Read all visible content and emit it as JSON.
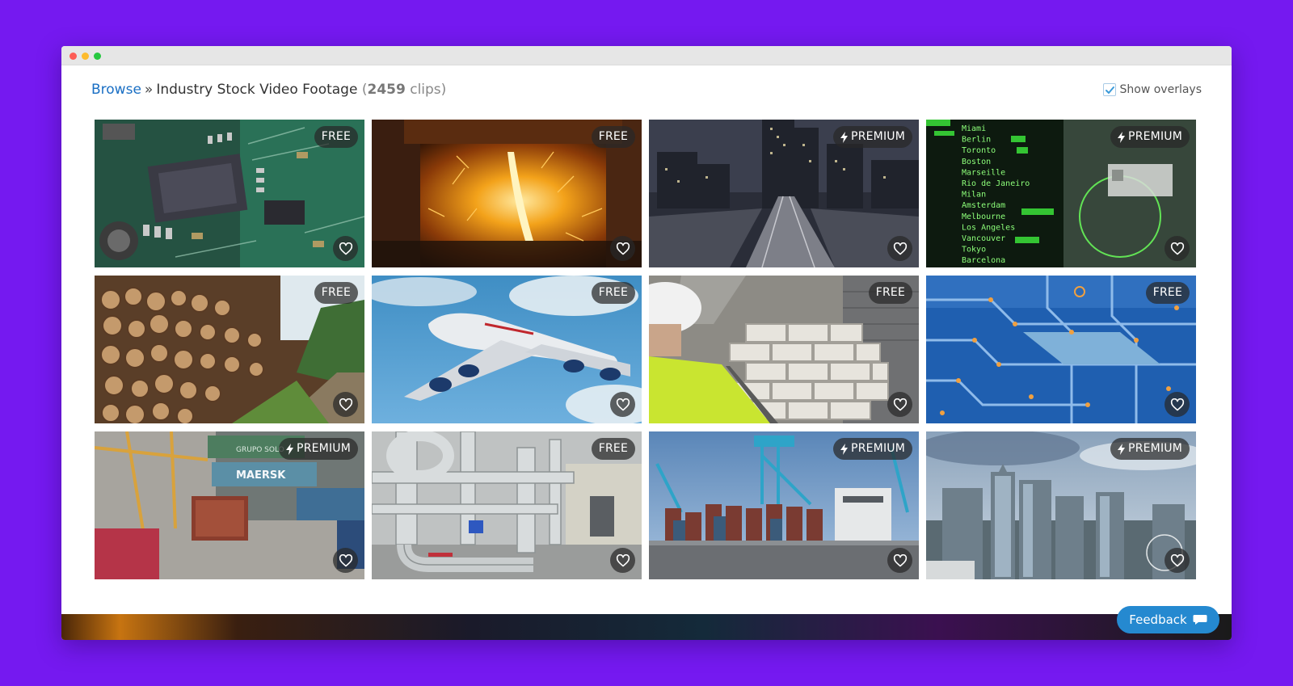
{
  "breadcrumb": {
    "root": "Browse",
    "separator": "»",
    "category": "Industry Stock Video Footage",
    "count_open": "(",
    "count_value": "2459",
    "count_unit": " clips)"
  },
  "overlay_toggle": {
    "label": "Show overlays",
    "checked": true
  },
  "clips": [
    {
      "badge": "FREE",
      "premium": false,
      "thumb": "circuit-board"
    },
    {
      "badge": "FREE",
      "premium": false,
      "thumb": "molten-metal"
    },
    {
      "badge": "PREMIUM",
      "premium": true,
      "thumb": "city-rail-night"
    },
    {
      "badge": "PREMIUM",
      "premium": true,
      "thumb": "airport-departures-board"
    },
    {
      "badge": "FREE",
      "premium": false,
      "thumb": "log-pile"
    },
    {
      "badge": "FREE",
      "premium": false,
      "thumb": "airplane"
    },
    {
      "badge": "FREE",
      "premium": false,
      "thumb": "bricklayer"
    },
    {
      "badge": "FREE",
      "premium": false,
      "thumb": "blue-circuit"
    },
    {
      "badge": "PREMIUM",
      "premium": true,
      "thumb": "shipping-port"
    },
    {
      "badge": "FREE",
      "premium": false,
      "thumb": "industrial-pipes"
    },
    {
      "badge": "PREMIUM",
      "premium": true,
      "thumb": "container-ship"
    },
    {
      "badge": "PREMIUM",
      "premium": true,
      "thumb": "city-skyline"
    }
  ],
  "departures_board": {
    "cities": [
      "Miami",
      "Berlin",
      "Toronto",
      "Boston",
      "Marseille",
      "Rio de Janeiro",
      "Milan",
      "Amsterdam",
      "Melbourne",
      "Los Angeles",
      "Vancouver",
      "Tokyo",
      "Barcelona"
    ]
  },
  "container_labels": [
    "MAERSK",
    "GRUPO SOLO"
  ],
  "icons": {
    "favorite": "heart-icon",
    "premium": "bolt-icon",
    "feedback": "chat-bubble-icon",
    "checkbox": "checkmark-icon"
  },
  "feedback": {
    "label": "Feedback"
  },
  "colors": {
    "background": "#7519f0",
    "link": "#1a6fc4",
    "feedback_button": "#2589d0",
    "badge_bg": "rgba(40,40,40,0.72)"
  }
}
